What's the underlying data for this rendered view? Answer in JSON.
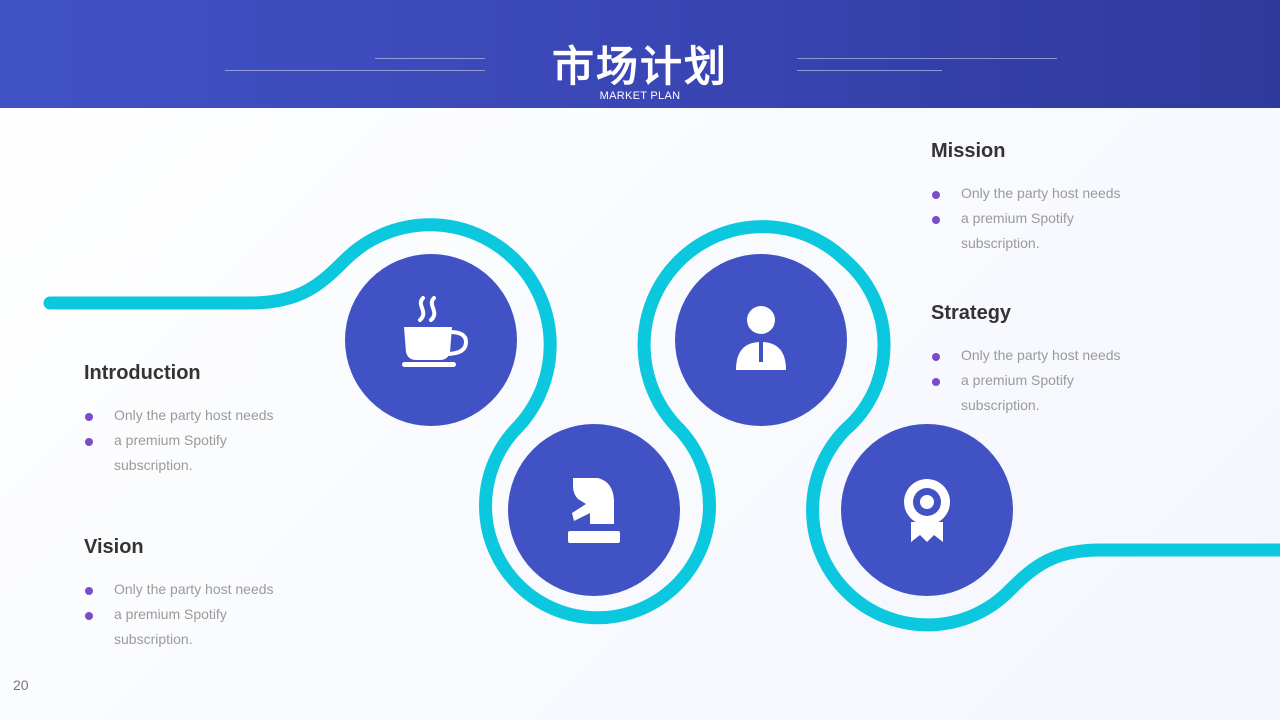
{
  "header": {
    "title": "市场计划",
    "subtitle": "MARKET PLAN"
  },
  "colors": {
    "header": "#3a46b5",
    "circle": "#4152c5",
    "path": "#0cc8df",
    "bullet": "#7b4cc9"
  },
  "nodes": [
    {
      "icon": "coffee-cup-icon"
    },
    {
      "icon": "chess-knight-icon"
    },
    {
      "icon": "person-icon"
    },
    {
      "icon": "award-badge-icon"
    }
  ],
  "sections": {
    "introduction": {
      "title": "Introduction",
      "line1": "Only the party host needs",
      "line2": "a premium Spotify",
      "line3": "subscription."
    },
    "vision": {
      "title": "Vision",
      "line1": "Only the party host needs",
      "line2": "a premium Spotify",
      "line3": "subscription."
    },
    "mission": {
      "title": "Mission",
      "line1": "Only the party host needs",
      "line2": "a premium Spotify",
      "line3": "subscription."
    },
    "strategy": {
      "title": "Strategy",
      "line1": "Only the party host needs",
      "line2": "a premium Spotify",
      "line3": "subscription."
    }
  },
  "page_number": "20"
}
